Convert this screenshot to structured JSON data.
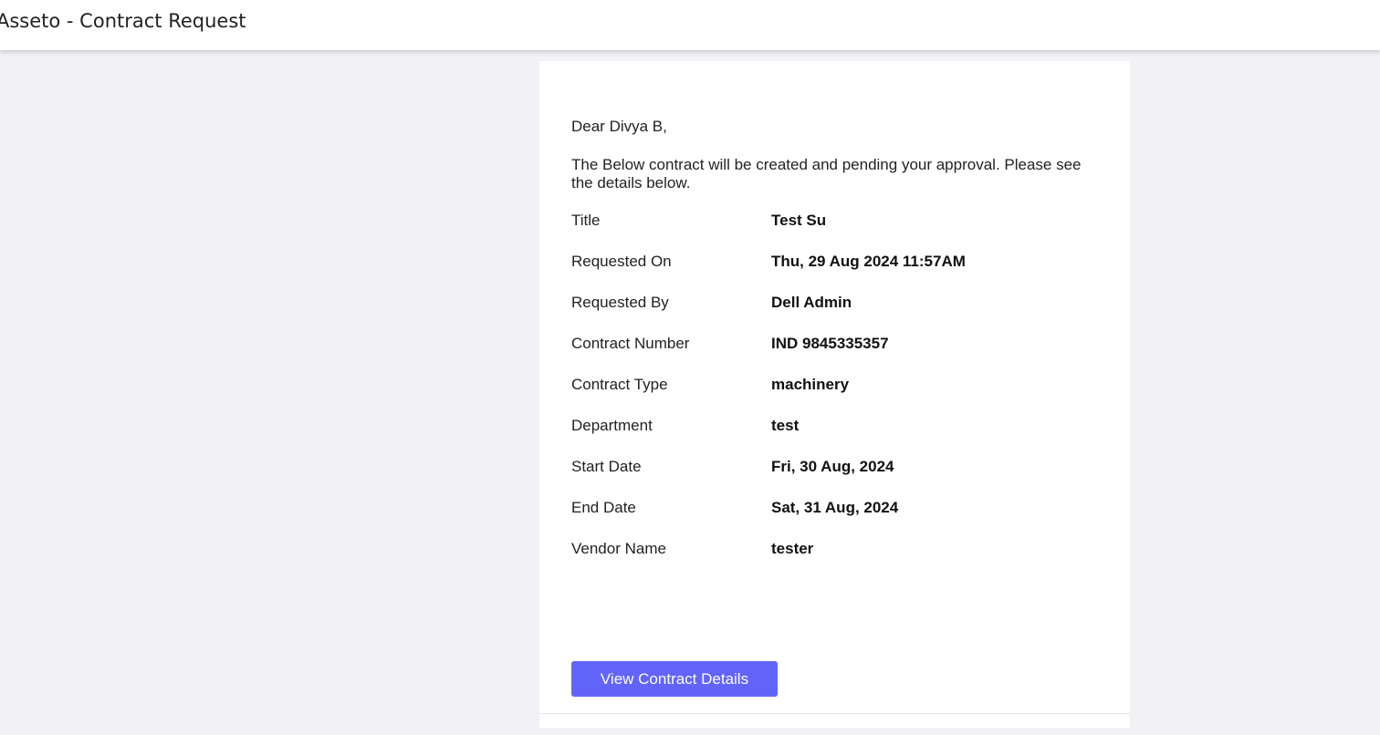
{
  "header": {
    "title": "Asseto - Contract Request"
  },
  "email": {
    "greeting": "Dear Divya B,",
    "intro": "The Below contract will be created and pending your approval. Please see the details below.",
    "details": [
      {
        "label": "Title",
        "value": "Test Su"
      },
      {
        "label": "Requested On",
        "value": "Thu, 29 Aug 2024 11:57AM"
      },
      {
        "label": "Requested By",
        "value": "Dell Admin"
      },
      {
        "label": "Contract Number",
        "value": "IND 9845335357"
      },
      {
        "label": "Contract Type",
        "value": "machinery"
      },
      {
        "label": "Department",
        "value": "test"
      },
      {
        "label": "Start Date",
        "value": "Fri, 30 Aug, 2024"
      },
      {
        "label": "End Date",
        "value": "Sat, 31 Aug, 2024"
      },
      {
        "label": "Vendor Name",
        "value": "tester"
      }
    ],
    "button_label": "View Contract Details"
  },
  "colors": {
    "background": "#f2f2f6",
    "card": "#ffffff",
    "button": "#6264f9"
  }
}
